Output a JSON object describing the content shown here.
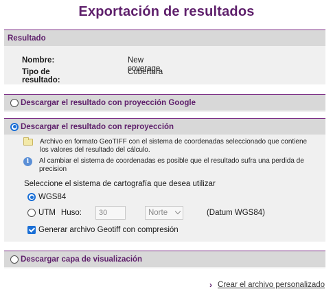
{
  "page": {
    "title": "Exportación de resultados"
  },
  "resultado": {
    "heading": "Resultado",
    "nombre_label": "Nombre:",
    "nombre_value": "New coverage",
    "tipo_label": "Tipo de resultado:",
    "tipo_value": "Cobertura"
  },
  "google_option": {
    "label": "Descargar el resultado con proyección Google",
    "selected": false
  },
  "reproj_option": {
    "label": "Descargar el resultado con reproyección",
    "selected": true,
    "info_file": "Archivo en formato GeoTIFF con el sistema de coordenadas seleccionado que contiene los valores del resultado del cálculo.",
    "info_warning": "Al cambiar el sistema de coordenadas es posible que el resultado sufra una perdida de precision",
    "select_prompt": "Seleccione el sistema de cartografía que desea utilizar",
    "wgs84_label": "WGS84",
    "wgs84_selected": true,
    "utm_label": "UTM",
    "utm_selected": false,
    "huso_label": "Huso:",
    "huso_value": "30",
    "hemisphere_value": "Norte",
    "datum_label": "(Datum WGS84)",
    "geotiff_compress_label": "Generar archivo Geotiff con compresión",
    "geotiff_compress_checked": true
  },
  "capa_option": {
    "label": "Descargar capa de visualización",
    "selected": false
  },
  "footer": {
    "create_link": "Crear el archivo personalizado"
  },
  "colors": {
    "accent": "#5e1f6b",
    "header_bg": "#d8d8d8",
    "panel_bg": "#f0f0f0",
    "radio_blue": "#1a6fd6"
  },
  "icons": {
    "file": "folder-icon",
    "info": "info-icon",
    "link_arrow": "chevron-right-icon"
  }
}
